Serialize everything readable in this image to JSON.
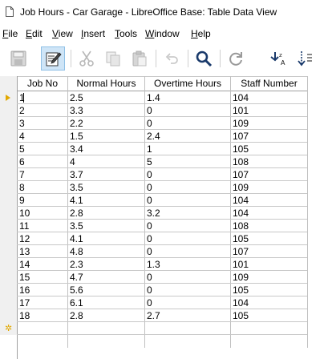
{
  "window": {
    "title": "Job Hours - Car Garage - LibreOffice Base: Table Data View"
  },
  "menu": {
    "items": [
      {
        "pre": "",
        "key": "F",
        "post": "ile"
      },
      {
        "pre": "",
        "key": "E",
        "post": "dit"
      },
      {
        "pre": "",
        "key": "V",
        "post": "iew"
      },
      {
        "pre": "",
        "key": "I",
        "post": "nsert"
      },
      {
        "pre": "",
        "key": "T",
        "post": "ools"
      },
      {
        "pre": "",
        "key": "W",
        "post": "indow"
      },
      {
        "pre": "",
        "key": "H",
        "post": "elp"
      }
    ]
  },
  "toolbar": {
    "buttons": [
      {
        "name": "save-icon",
        "state": "disabled"
      },
      {
        "name": "edit-data-icon",
        "state": "active"
      },
      {
        "name": "cut-icon",
        "state": "disabled"
      },
      {
        "name": "copy-icon",
        "state": "disabled"
      },
      {
        "name": "paste-icon",
        "state": "disabled"
      },
      {
        "name": "undo-icon",
        "state": "disabled"
      },
      {
        "name": "find-icon",
        "state": "enabled"
      },
      {
        "name": "refresh-icon",
        "state": "enabled"
      },
      {
        "name": "sort-icon",
        "state": "enabled"
      },
      {
        "name": "sort-ascending-icon",
        "state": "enabled"
      }
    ]
  },
  "table": {
    "columns": [
      "Job No",
      "Normal Hours",
      "Overtime Hours",
      "Staff Number"
    ],
    "rows": [
      [
        "1",
        "2.5",
        "1.4",
        "104"
      ],
      [
        "2",
        "3.3",
        "0",
        "101"
      ],
      [
        "3",
        "2.2",
        "0",
        "109"
      ],
      [
        "4",
        "1.5",
        "2.4",
        "107"
      ],
      [
        "5",
        "3.4",
        "1",
        "105"
      ],
      [
        "6",
        "4",
        "5",
        "108"
      ],
      [
        "7",
        "3.7",
        "0",
        "107"
      ],
      [
        "8",
        "3.5",
        "0",
        "109"
      ],
      [
        "9",
        "4.1",
        "0",
        "104"
      ],
      [
        "10",
        "2.8",
        "3.2",
        "104"
      ],
      [
        "11",
        "3.5",
        "0",
        "108"
      ],
      [
        "12",
        "4.1",
        "0",
        "105"
      ],
      [
        "13",
        "4.8",
        "0",
        "107"
      ],
      [
        "14",
        "2.3",
        "1.3",
        "101"
      ],
      [
        "15",
        "4.7",
        "0",
        "109"
      ],
      [
        "16",
        "5.6",
        "0",
        "105"
      ],
      [
        "17",
        "6.1",
        "0",
        "104"
      ],
      [
        "18",
        "2.8",
        "2.7",
        "105"
      ]
    ],
    "current_row": 1,
    "new_row_marker": "✲"
  },
  "colors": {
    "row_marker": "#e2a800",
    "active_button_bg": "#cfe5f7",
    "grid_line": "#c0c0c0"
  }
}
